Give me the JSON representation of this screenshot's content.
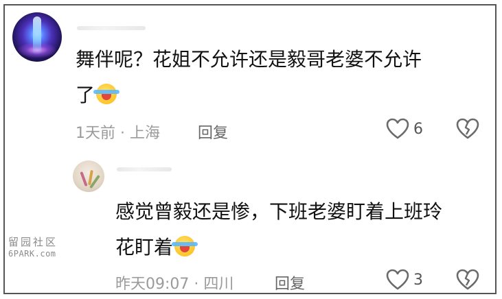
{
  "comments": [
    {
      "text_line1": "舞伴呢？花姐不允许还是毅哥老婆不允许",
      "text_line2": "了",
      "emoji_icon": "crying-laughing-emoji",
      "time": "1天前",
      "separator": "·",
      "location": "上海",
      "reply_label": "回复",
      "like_count": "6",
      "avatar_icon": "galaxy-waterfall-avatar"
    },
    {
      "text_line1": "感觉曾毅还是惨，下班老婆盯着上班玲",
      "text_line2": "花盯着",
      "emoji_icon": "crying-laughing-emoji",
      "time": "昨天09:07",
      "separator": "·",
      "location": "四川",
      "reply_label": "回复",
      "like_count": "3",
      "avatar_icon": "flower-avatar"
    }
  ],
  "watermark": {
    "cn": "留园社区",
    "en": "6PARK.com"
  },
  "colors": {
    "meta_gray": "#9a9a9a",
    "text": "#111111",
    "border": "#555555"
  }
}
